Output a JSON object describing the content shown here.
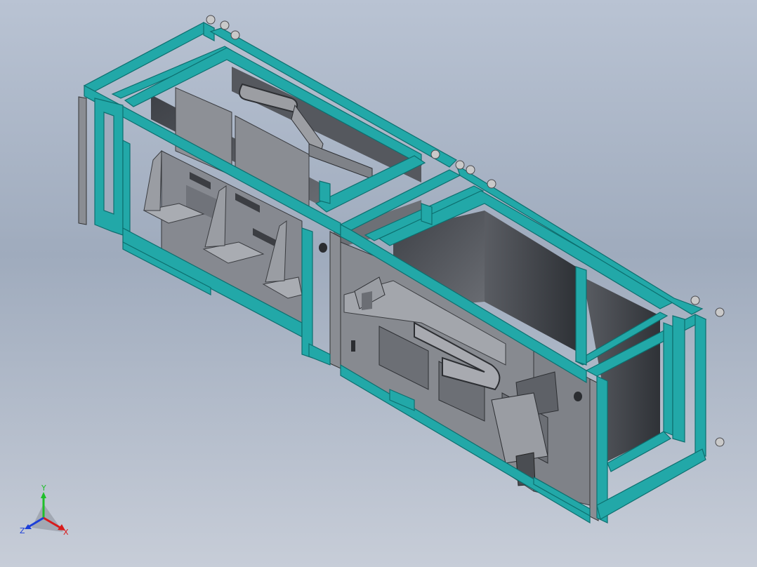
{
  "viewport": {
    "background_top": "#b9c3d3",
    "background_bottom": "#c7cdd8"
  },
  "model": {
    "frame_color": "#22a8a8",
    "frame_edge_color": "#0d6f6f",
    "panel_color": "#7c7f85",
    "panel_dark_color": "#4b4e54",
    "extrusion_color": "#8a8d93",
    "foot_color": "#c9c9c9"
  },
  "triad": {
    "x_label": "X",
    "y_label": "Y",
    "z_label": "Z",
    "x_color": "#d81b1b",
    "y_color": "#1fbf2a",
    "z_color": "#1d3fd8"
  }
}
